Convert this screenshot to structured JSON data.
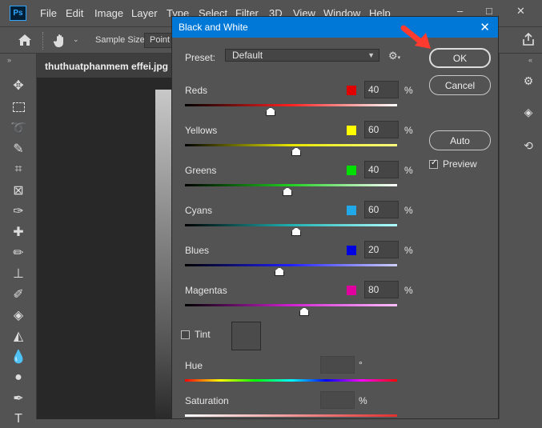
{
  "app": {
    "logo": "Ps",
    "menu": [
      "File",
      "Edit",
      "Image",
      "Layer",
      "Type",
      "Select",
      "Filter",
      "3D",
      "View",
      "Window",
      "Help"
    ],
    "window_controls": [
      "–",
      "□",
      "✕"
    ]
  },
  "options_bar": {
    "sample_size_label": "Sample Size:",
    "sample_size_value": "Point"
  },
  "document": {
    "tab_title": "thuthuatphanmem effei.jpg @"
  },
  "dialog": {
    "title": "Black and White",
    "preset_label": "Preset:",
    "preset_value": "Default",
    "sliders": [
      {
        "label": "Reds",
        "value": "40",
        "color": "#e00000",
        "track": "linear-gradient(90deg,#000,#ff2020,#fff)",
        "pos": 0.4
      },
      {
        "label": "Yellows",
        "value": "60",
        "color": "#ffff00",
        "track": "linear-gradient(90deg,#000,#e6e600,#ffff80)",
        "pos": 0.52
      },
      {
        "label": "Greens",
        "value": "40",
        "color": "#00e000",
        "track": "linear-gradient(90deg,#000,#20d020,#fff)",
        "pos": 0.48
      },
      {
        "label": "Cyans",
        "value": "60",
        "color": "#20a8e8",
        "track": "linear-gradient(90deg,#000,#20b0b0,#b0ffff)",
        "pos": 0.52
      },
      {
        "label": "Blues",
        "value": "20",
        "color": "#0000e0",
        "track": "linear-gradient(90deg,#000,#2020ff,#d0d0ff)",
        "pos": 0.44
      },
      {
        "label": "Magentas",
        "value": "80",
        "color": "#e000a0",
        "track": "linear-gradient(90deg,#000,#d020d0,#ffc0ff)",
        "pos": 0.56
      }
    ],
    "percent": "%",
    "tint_label": "Tint",
    "hue_label": "Hue",
    "hue_unit": "°",
    "saturation_label": "Saturation",
    "saturation_unit": "%",
    "buttons": {
      "ok": "OK",
      "cancel": "Cancel",
      "auto": "Auto"
    },
    "preview_label": "Preview",
    "preview_checked": true,
    "tint_checked": false
  }
}
